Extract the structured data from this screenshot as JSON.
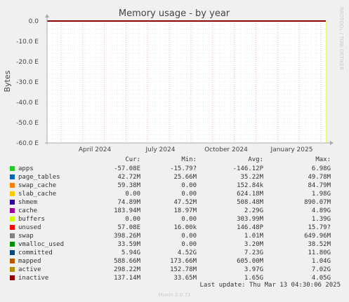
{
  "chart_data": {
    "type": "area",
    "title": "Memory usage - by year",
    "ylabel": "Bytes",
    "yticks": [
      "0.0",
      "-10.0 E",
      "-20.0 E",
      "-30.0 E",
      "-40.0 E",
      "-50.0 E",
      "-60.0 E"
    ],
    "ytick_values": [
      0,
      -10,
      -20,
      -30,
      -40,
      -50,
      -60
    ],
    "ylim": [
      -60,
      0
    ],
    "xticks": [
      "April 2024",
      "July 2024",
      "October 2024",
      "January 2025"
    ],
    "grid": true,
    "side_label": "RRDTOOL / TOBI OETIKER",
    "series_line_note": "all series near 0.0 across the year",
    "legend_headers": {
      "cur": "Cur:",
      "min": "Min:",
      "avg": "Avg:",
      "max": "Max:"
    },
    "legend": [
      {
        "name": "apps",
        "color": "#22cc22",
        "cur": "-57.08E",
        "min": "-15.79?",
        "avg": "-146.12P",
        "max": "6.98G"
      },
      {
        "name": "page_tables",
        "color": "#0066b3",
        "cur": "42.72M",
        "min": "25.66M",
        "avg": "35.22M",
        "max": "49.78M"
      },
      {
        "name": "swap_cache",
        "color": "#ff8000",
        "cur": "59.38M",
        "min": "0.00",
        "avg": "152.84k",
        "max": "84.79M"
      },
      {
        "name": "slab_cache",
        "color": "#ffcc00",
        "cur": "0.00",
        "min": "0.00",
        "avg": "624.18M",
        "max": "1.98G"
      },
      {
        "name": "shmem",
        "color": "#330099",
        "cur": "74.89M",
        "min": "47.52M",
        "avg": "508.48M",
        "max": "890.07M"
      },
      {
        "name": "cache",
        "color": "#990099",
        "cur": "183.94M",
        "min": "18.97M",
        "avg": "2.29G",
        "max": "4.89G"
      },
      {
        "name": "buffers",
        "color": "#ccff00",
        "cur": "0.00",
        "min": "0.00",
        "avg": "303.99M",
        "max": "1.39G"
      },
      {
        "name": "unused",
        "color": "#ff0000",
        "cur": "57.08E",
        "min": "16.00k",
        "avg": "146.48P",
        "max": "15.79?"
      },
      {
        "name": "swap",
        "color": "#808080",
        "cur": "398.26M",
        "min": "0.00",
        "avg": "1.01M",
        "max": "649.96M"
      },
      {
        "name": "vmalloc_used",
        "color": "#008f00",
        "cur": "33.59M",
        "min": "0.00",
        "avg": "3.20M",
        "max": "38.52M"
      },
      {
        "name": "committed",
        "color": "#00487d",
        "cur": "5.94G",
        "min": "4.52G",
        "avg": "7.23G",
        "max": "11.80G"
      },
      {
        "name": "mapped",
        "color": "#b35a00",
        "cur": "588.66M",
        "min": "173.66M",
        "avg": "605.00M",
        "max": "1.04G"
      },
      {
        "name": "active",
        "color": "#b38f00",
        "cur": "298.22M",
        "min": "152.78M",
        "avg": "3.97G",
        "max": "7.02G"
      },
      {
        "name": "inactive",
        "color": "#8b0000",
        "cur": "137.14M",
        "min": "33.65M",
        "avg": "1.65G",
        "max": "4.05G"
      }
    ],
    "last_update": "Last update: Thu Mar 13 04:30:06 2025",
    "version": "Munin 2.0.73"
  }
}
